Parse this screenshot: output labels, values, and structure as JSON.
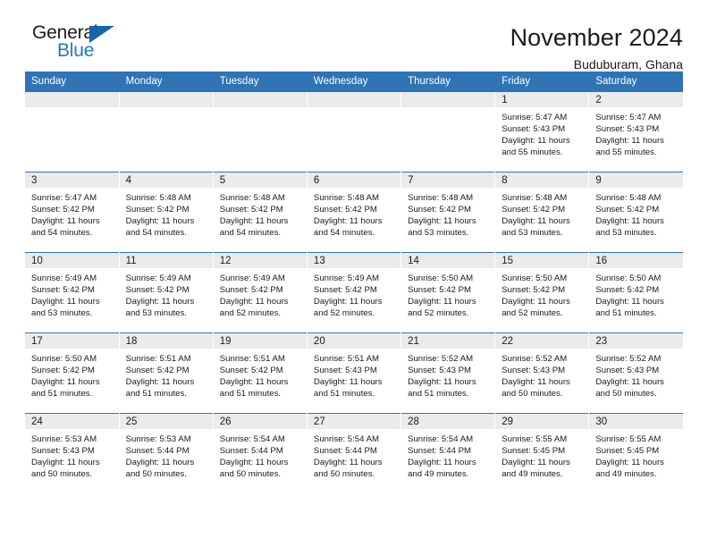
{
  "brand": {
    "name_part1": "General",
    "name_part2": "Blue",
    "triangle_color": "#1565a8",
    "blue_color": "#1f7ac0"
  },
  "header": {
    "title": "November 2024",
    "subtitle": "Buduburam, Ghana"
  },
  "theme": {
    "header_blue": "#2f74b5",
    "daynum_gray": "#ebebeb",
    "text": "#1b1b1b"
  },
  "weekdays": [
    "Sunday",
    "Monday",
    "Tuesday",
    "Wednesday",
    "Thursday",
    "Friday",
    "Saturday"
  ],
  "labels": {
    "sunrise": "Sunrise:",
    "sunset": "Sunset:",
    "daylight": "Daylight:"
  },
  "weeks": [
    [
      {
        "day": "",
        "blank": true
      },
      {
        "day": "",
        "blank": true
      },
      {
        "day": "",
        "blank": true
      },
      {
        "day": "",
        "blank": true
      },
      {
        "day": "",
        "blank": true
      },
      {
        "day": "1",
        "sunrise": "Sunrise: 5:47 AM",
        "sunset": "Sunset: 5:43 PM",
        "daylight": "Daylight: 11 hours and 55 minutes."
      },
      {
        "day": "2",
        "sunrise": "Sunrise: 5:47 AM",
        "sunset": "Sunset: 5:43 PM",
        "daylight": "Daylight: 11 hours and 55 minutes."
      }
    ],
    [
      {
        "day": "3",
        "sunrise": "Sunrise: 5:47 AM",
        "sunset": "Sunset: 5:42 PM",
        "daylight": "Daylight: 11 hours and 54 minutes."
      },
      {
        "day": "4",
        "sunrise": "Sunrise: 5:48 AM",
        "sunset": "Sunset: 5:42 PM",
        "daylight": "Daylight: 11 hours and 54 minutes."
      },
      {
        "day": "5",
        "sunrise": "Sunrise: 5:48 AM",
        "sunset": "Sunset: 5:42 PM",
        "daylight": "Daylight: 11 hours and 54 minutes."
      },
      {
        "day": "6",
        "sunrise": "Sunrise: 5:48 AM",
        "sunset": "Sunset: 5:42 PM",
        "daylight": "Daylight: 11 hours and 54 minutes."
      },
      {
        "day": "7",
        "sunrise": "Sunrise: 5:48 AM",
        "sunset": "Sunset: 5:42 PM",
        "daylight": "Daylight: 11 hours and 53 minutes."
      },
      {
        "day": "8",
        "sunrise": "Sunrise: 5:48 AM",
        "sunset": "Sunset: 5:42 PM",
        "daylight": "Daylight: 11 hours and 53 minutes."
      },
      {
        "day": "9",
        "sunrise": "Sunrise: 5:48 AM",
        "sunset": "Sunset: 5:42 PM",
        "daylight": "Daylight: 11 hours and 53 minutes."
      }
    ],
    [
      {
        "day": "10",
        "sunrise": "Sunrise: 5:49 AM",
        "sunset": "Sunset: 5:42 PM",
        "daylight": "Daylight: 11 hours and 53 minutes."
      },
      {
        "day": "11",
        "sunrise": "Sunrise: 5:49 AM",
        "sunset": "Sunset: 5:42 PM",
        "daylight": "Daylight: 11 hours and 53 minutes."
      },
      {
        "day": "12",
        "sunrise": "Sunrise: 5:49 AM",
        "sunset": "Sunset: 5:42 PM",
        "daylight": "Daylight: 11 hours and 52 minutes."
      },
      {
        "day": "13",
        "sunrise": "Sunrise: 5:49 AM",
        "sunset": "Sunset: 5:42 PM",
        "daylight": "Daylight: 11 hours and 52 minutes."
      },
      {
        "day": "14",
        "sunrise": "Sunrise: 5:50 AM",
        "sunset": "Sunset: 5:42 PM",
        "daylight": "Daylight: 11 hours and 52 minutes."
      },
      {
        "day": "15",
        "sunrise": "Sunrise: 5:50 AM",
        "sunset": "Sunset: 5:42 PM",
        "daylight": "Daylight: 11 hours and 52 minutes."
      },
      {
        "day": "16",
        "sunrise": "Sunrise: 5:50 AM",
        "sunset": "Sunset: 5:42 PM",
        "daylight": "Daylight: 11 hours and 51 minutes."
      }
    ],
    [
      {
        "day": "17",
        "sunrise": "Sunrise: 5:50 AM",
        "sunset": "Sunset: 5:42 PM",
        "daylight": "Daylight: 11 hours and 51 minutes."
      },
      {
        "day": "18",
        "sunrise": "Sunrise: 5:51 AM",
        "sunset": "Sunset: 5:42 PM",
        "daylight": "Daylight: 11 hours and 51 minutes."
      },
      {
        "day": "19",
        "sunrise": "Sunrise: 5:51 AM",
        "sunset": "Sunset: 5:42 PM",
        "daylight": "Daylight: 11 hours and 51 minutes."
      },
      {
        "day": "20",
        "sunrise": "Sunrise: 5:51 AM",
        "sunset": "Sunset: 5:43 PM",
        "daylight": "Daylight: 11 hours and 51 minutes."
      },
      {
        "day": "21",
        "sunrise": "Sunrise: 5:52 AM",
        "sunset": "Sunset: 5:43 PM",
        "daylight": "Daylight: 11 hours and 51 minutes."
      },
      {
        "day": "22",
        "sunrise": "Sunrise: 5:52 AM",
        "sunset": "Sunset: 5:43 PM",
        "daylight": "Daylight: 11 hours and 50 minutes."
      },
      {
        "day": "23",
        "sunrise": "Sunrise: 5:52 AM",
        "sunset": "Sunset: 5:43 PM",
        "daylight": "Daylight: 11 hours and 50 minutes."
      }
    ],
    [
      {
        "day": "24",
        "sunrise": "Sunrise: 5:53 AM",
        "sunset": "Sunset: 5:43 PM",
        "daylight": "Daylight: 11 hours and 50 minutes."
      },
      {
        "day": "25",
        "sunrise": "Sunrise: 5:53 AM",
        "sunset": "Sunset: 5:44 PM",
        "daylight": "Daylight: 11 hours and 50 minutes."
      },
      {
        "day": "26",
        "sunrise": "Sunrise: 5:54 AM",
        "sunset": "Sunset: 5:44 PM",
        "daylight": "Daylight: 11 hours and 50 minutes."
      },
      {
        "day": "27",
        "sunrise": "Sunrise: 5:54 AM",
        "sunset": "Sunset: 5:44 PM",
        "daylight": "Daylight: 11 hours and 50 minutes."
      },
      {
        "day": "28",
        "sunrise": "Sunrise: 5:54 AM",
        "sunset": "Sunset: 5:44 PM",
        "daylight": "Daylight: 11 hours and 49 minutes."
      },
      {
        "day": "29",
        "sunrise": "Sunrise: 5:55 AM",
        "sunset": "Sunset: 5:45 PM",
        "daylight": "Daylight: 11 hours and 49 minutes."
      },
      {
        "day": "30",
        "sunrise": "Sunrise: 5:55 AM",
        "sunset": "Sunset: 5:45 PM",
        "daylight": "Daylight: 11 hours and 49 minutes."
      }
    ]
  ]
}
